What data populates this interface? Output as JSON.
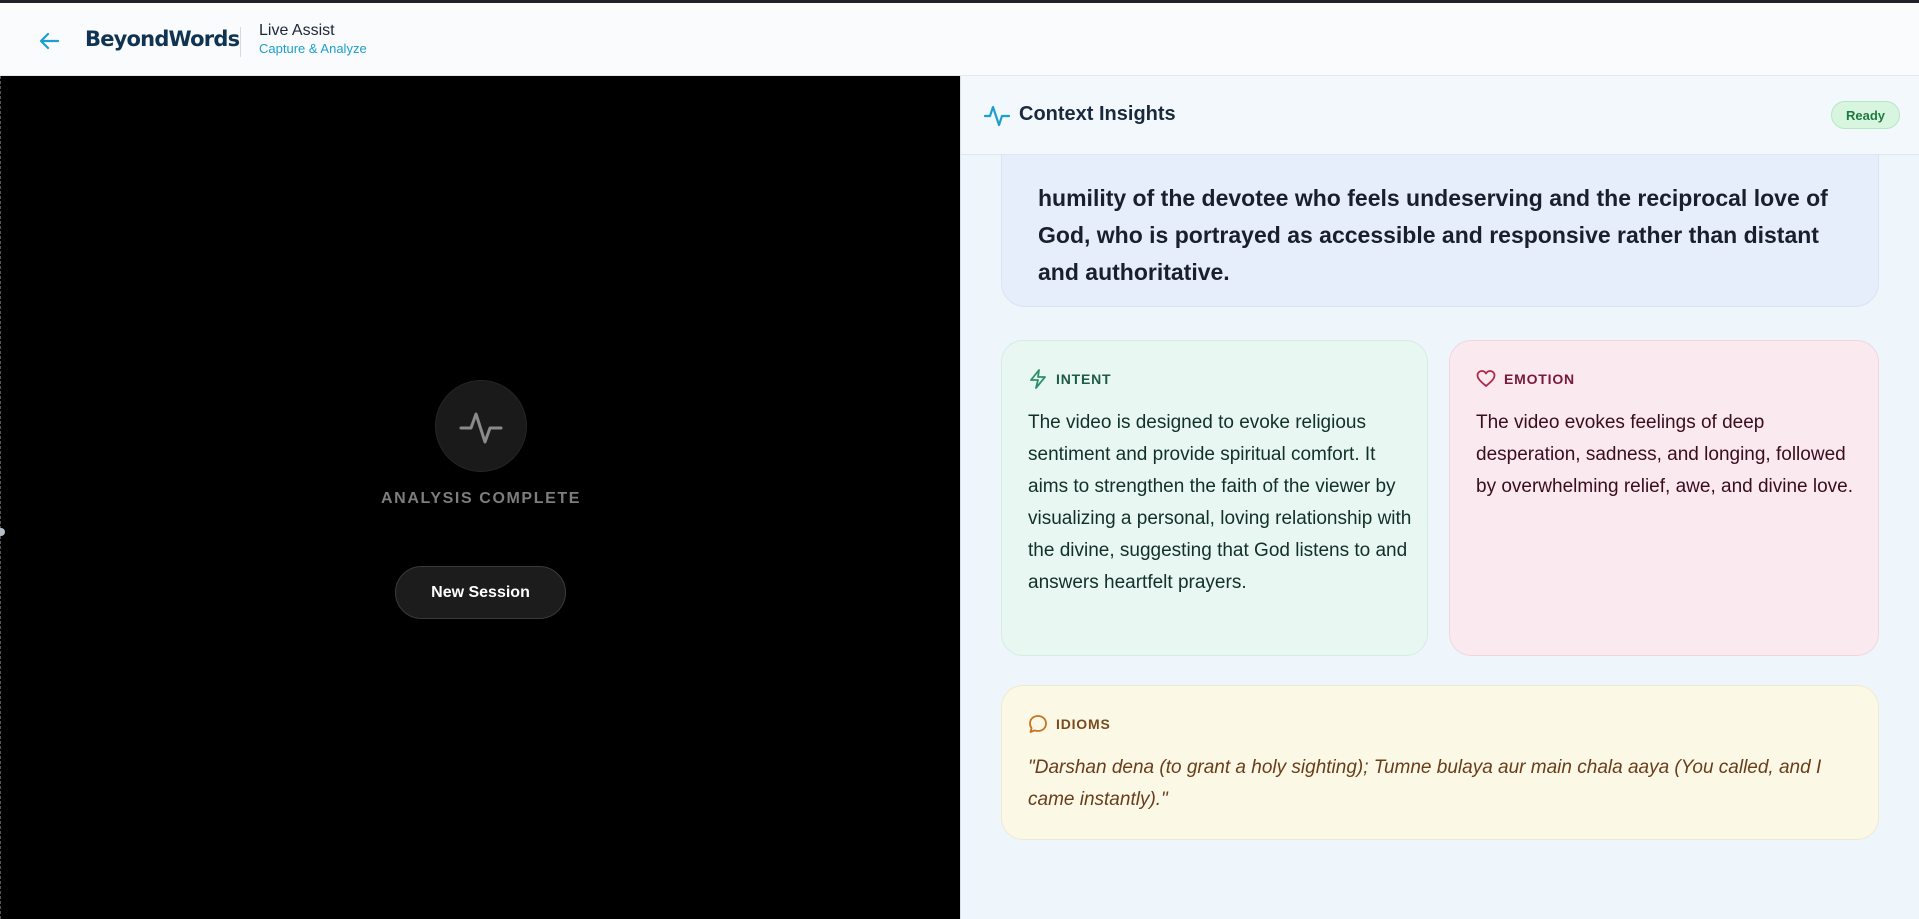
{
  "header": {
    "brand": "BeyondWords",
    "title": "Live Assist",
    "subtitle": "Capture & Analyze",
    "back_icon": "arrow-left-icon"
  },
  "left_pane": {
    "status": "ANALYSIS COMPLETE",
    "new_session_label": "New Session",
    "status_icon": "activity-pulse-icon"
  },
  "right_pane": {
    "title": "Context Insights",
    "badge": "Ready",
    "title_icon": "activity-pulse-icon",
    "summary": "humility of the devotee who feels undeserving and the reciprocal love of God, who is portrayed as accessible and responsive rather than distant and authoritative.",
    "intent": {
      "label": "INTENT",
      "icon": "lightning-icon",
      "text": "The video is designed to evoke religious sentiment and provide spiritual comfort. It aims to strengthen the faith of the viewer by visualizing a personal, loving relationship with the divine, suggesting that God listens to and answers heartfelt prayers."
    },
    "emotion": {
      "label": "EMOTION",
      "icon": "heart-icon",
      "text": "The video evokes feelings of deep desperation, sadness, and longing, followed by overwhelming relief, awe, and divine love."
    },
    "idioms": {
      "label": "IDIOMS",
      "icon": "speech-bubble-icon",
      "text": "\"Darshan dena (to grant a holy sighting); Tumne bulaya aur main chala aaya (You called, and I came instantly).\""
    }
  },
  "colors": {
    "accent": "#1d9fce",
    "brand": "#0f3350",
    "ready_bg": "#d8f5e0",
    "intent_bg": "#e8f7f1",
    "emotion_bg": "#fbe9f0",
    "idioms_bg": "#fbf9e6"
  }
}
